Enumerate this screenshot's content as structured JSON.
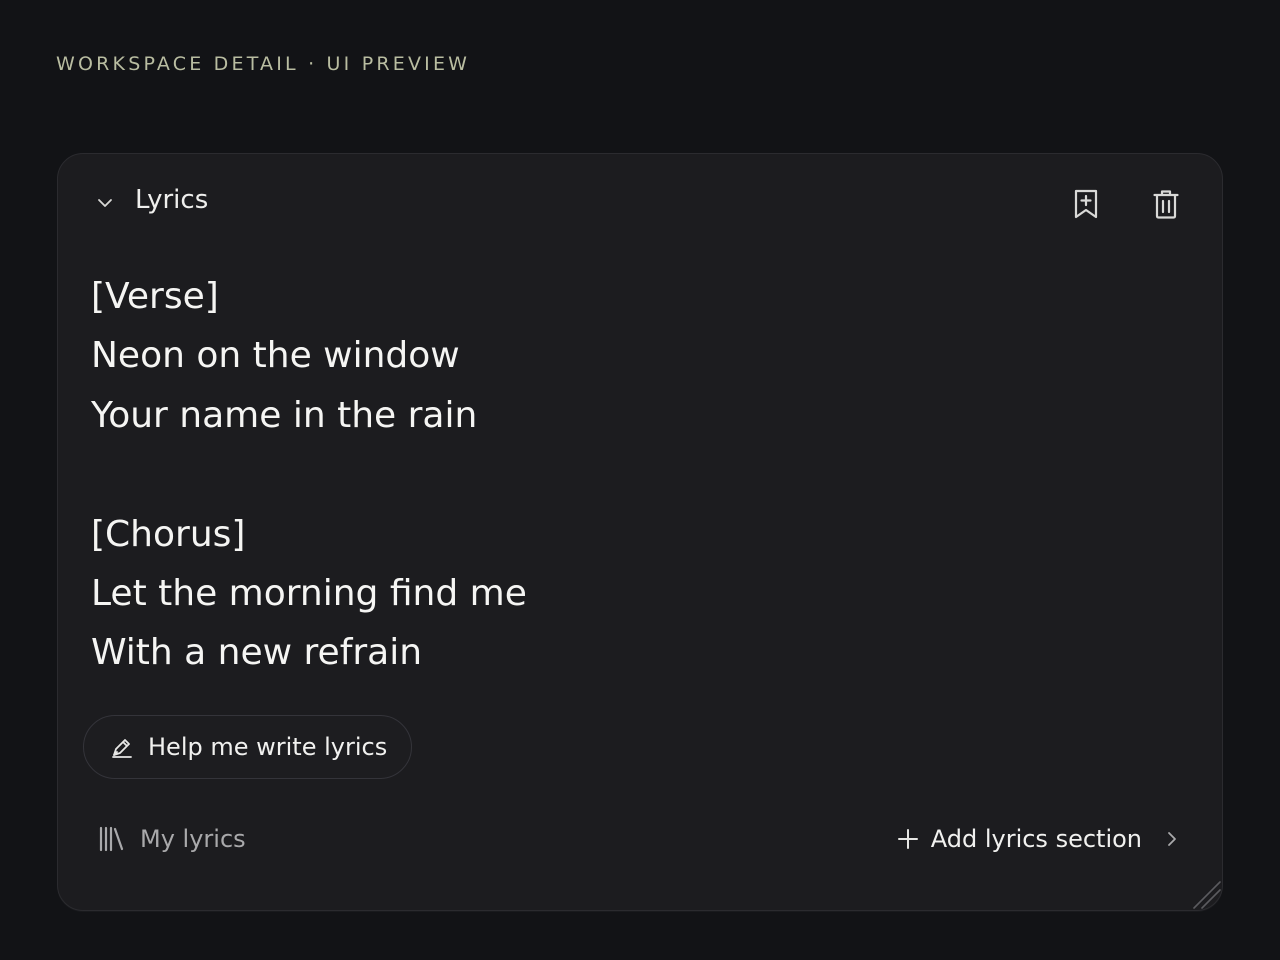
{
  "page": {
    "label": "WORKSPACE DETAIL · UI PREVIEW"
  },
  "panel": {
    "title": "Lyrics",
    "icons": {
      "collapse": "chevron-down-icon",
      "bookmark": "bookmark-plus-icon",
      "delete": "trash-icon"
    },
    "lyrics": [
      "[Verse]",
      "Neon on the window",
      "Your name in the rain",
      "",
      "[Chorus]",
      "Let the morning find me",
      "With a new refrain"
    ],
    "help_button": {
      "label": "Help me write lyrics",
      "icon": "pen-sparkle-icon"
    },
    "footer": {
      "my_lyrics_label": "My lyrics",
      "my_lyrics_icon": "library-icon",
      "add_section_label": "Add lyrics section",
      "add_icon": "plus-icon",
      "chevron_icon": "chevron-right-icon"
    }
  },
  "colors": {
    "background": "#121316",
    "panel": "#1c1c1f",
    "accent_label": "#b9bda1",
    "text": "#f2f2f0",
    "muted_text": "#a9a9ab"
  }
}
